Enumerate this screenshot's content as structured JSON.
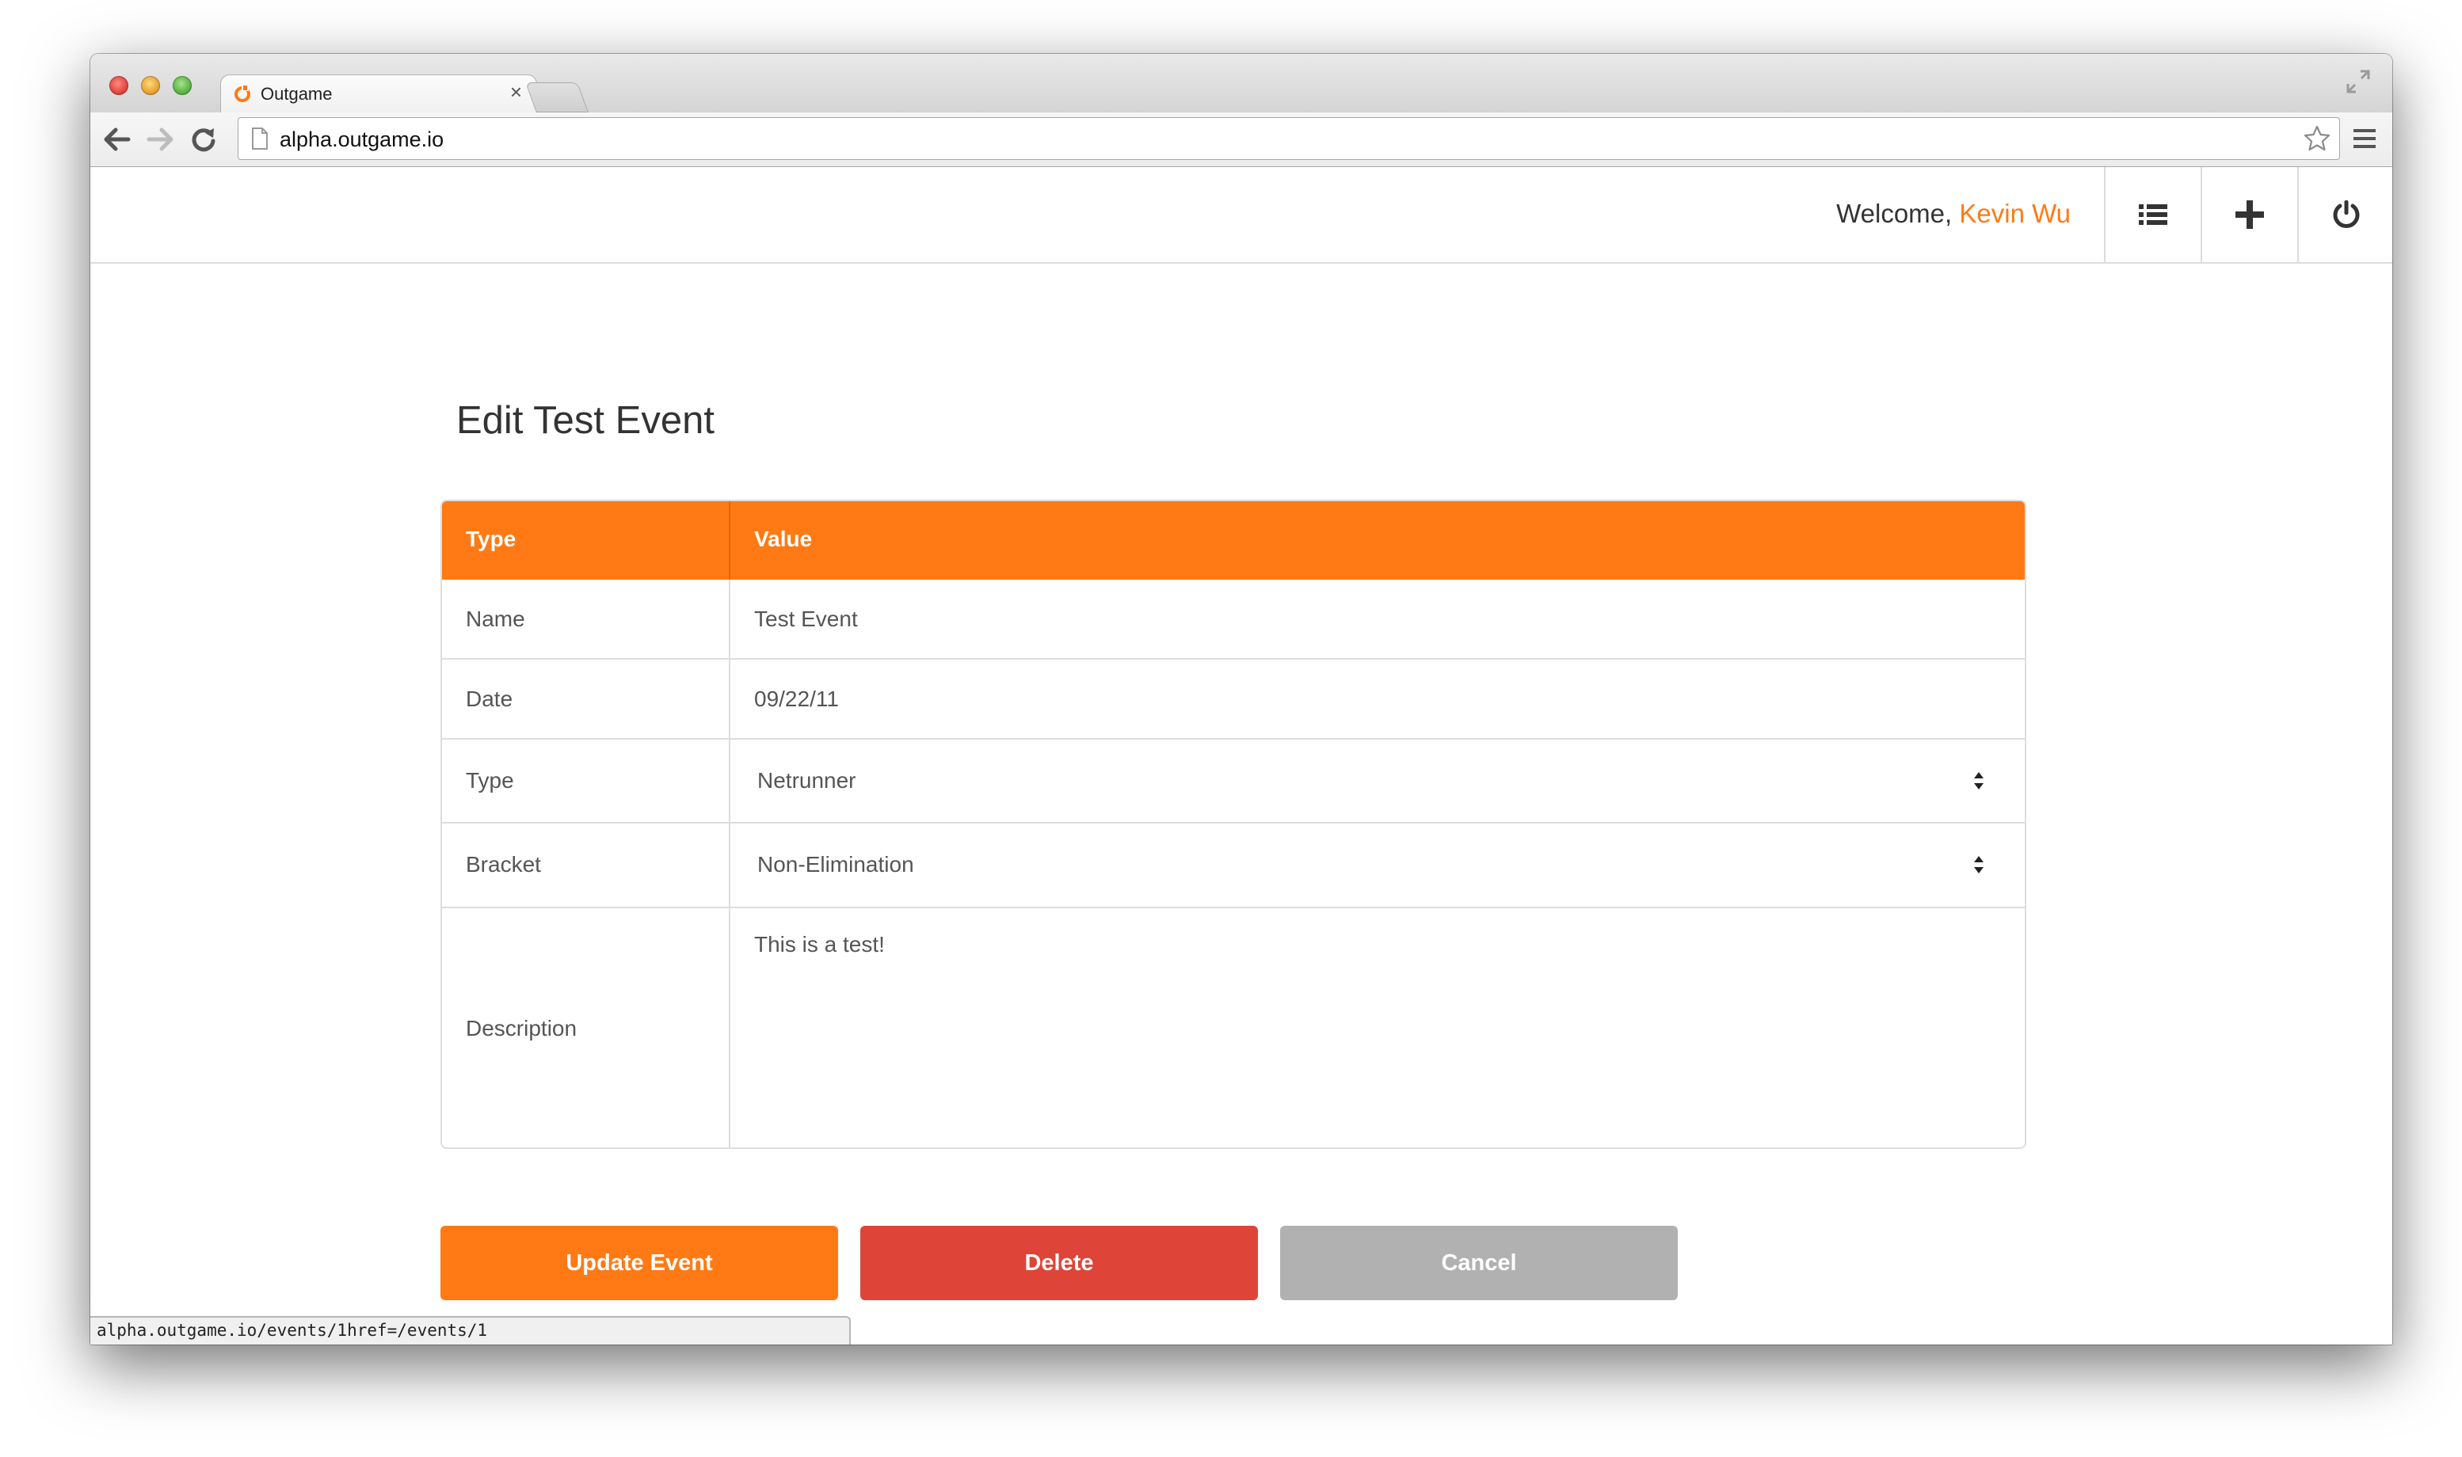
{
  "browser": {
    "tab_title": "Outgame",
    "tab_close": "×",
    "url": "alpha.outgame.io",
    "status_url": "alpha.outgame.io/events/1href=/events/1"
  },
  "header": {
    "welcome_prefix": "Welcome, ",
    "user_name": "Kevin Wu",
    "icons": [
      "list-icon",
      "plus-icon",
      "power-icon"
    ]
  },
  "page": {
    "title": "Edit Test Event"
  },
  "form": {
    "header": {
      "type": "Type",
      "value": "Value"
    },
    "rows": [
      {
        "label": "Name",
        "value": "Test Event"
      },
      {
        "label": "Date",
        "value": "09/22/11"
      },
      {
        "label": "Type",
        "value": "Netrunner"
      },
      {
        "label": "Bracket",
        "value": "Non-Elimination"
      },
      {
        "label": "Description",
        "value": "This is a test!"
      }
    ]
  },
  "buttons": {
    "update": "Update Event",
    "delete": "Delete",
    "cancel": "Cancel"
  },
  "colors": {
    "accent": "#ff7a14",
    "danger": "#df4438",
    "muted": "#b1b1b1"
  }
}
